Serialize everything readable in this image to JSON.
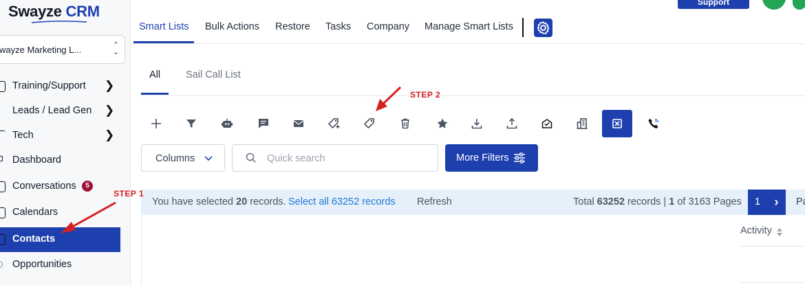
{
  "brand": {
    "name_part1": "Swayze",
    "name_part2": " CRM"
  },
  "account": {
    "name": "wayze Marketing L..."
  },
  "sidebar": {
    "items": [
      {
        "label": "Training/Support",
        "chevron": true
      },
      {
        "label": "Leads / Lead Gen",
        "chevron": true
      },
      {
        "label": "Tech",
        "chevron": true
      },
      {
        "label": "Dashboard"
      },
      {
        "label": "Conversations",
        "badge": "5"
      },
      {
        "label": "Calendars"
      },
      {
        "label": "Contacts",
        "active": true
      },
      {
        "label": "Opportunities"
      }
    ]
  },
  "header": {
    "tabs": [
      "Smart Lists",
      "Bulk Actions",
      "Restore",
      "Tasks",
      "Company",
      "Manage Smart Lists"
    ],
    "active_tab": "Smart Lists",
    "support_label": "Support"
  },
  "subtabs": [
    "All",
    "Sail Call List"
  ],
  "toolbar": {
    "icons": [
      "plus-icon",
      "filter-icon",
      "robot-icon",
      "message-icon",
      "email-icon",
      "tag-add-icon",
      "tag-remove-icon",
      "trash-icon",
      "star-icon",
      "download-icon",
      "upload-icon",
      "mail-open-icon",
      "building-icon",
      "merge-icon",
      "phone-call-icon"
    ]
  },
  "filters": {
    "columns_label": "Columns",
    "search_placeholder": "Quick search",
    "more_filters_label": "More Filters"
  },
  "selection": {
    "prefix": "You have selected",
    "count": "20",
    "suffix": "records.",
    "select_all": "Select all 63252 records",
    "refresh": "Refresh",
    "total_prefix": "Total",
    "total_count": "63252",
    "total_mid": "records |",
    "page": "1",
    "page_mid": "of 3163 Pages"
  },
  "pager": {
    "current": "1",
    "next_label": "›",
    "cut_text": "Pa"
  },
  "table": {
    "column_activity": "Activity"
  },
  "annotations": {
    "step1": "STEP 1",
    "step2": "STEP 2"
  },
  "colors": {
    "primary": "#1e40af",
    "annotation": "#d42020",
    "badge": "#9f1239",
    "link": "#1e7ad6"
  }
}
